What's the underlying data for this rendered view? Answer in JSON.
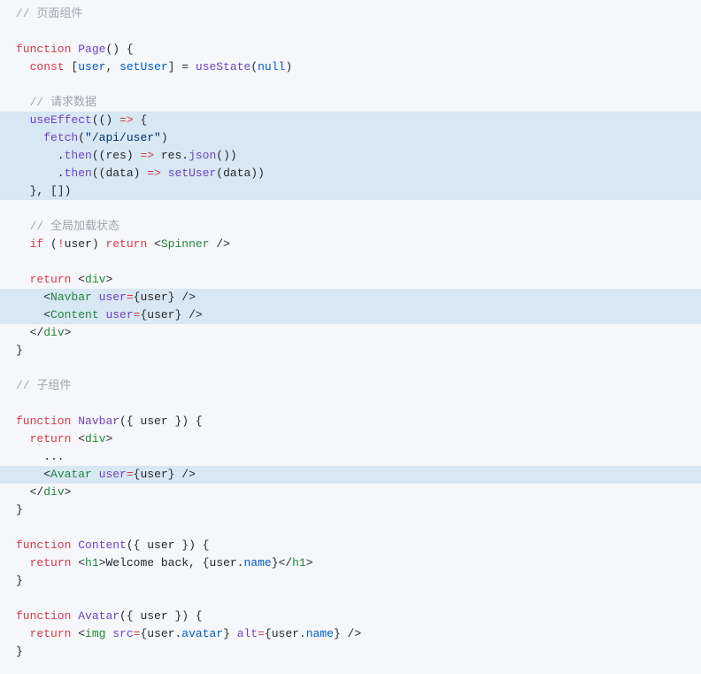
{
  "lines": [
    {
      "hl": false,
      "segs": [
        [
          "c-comment",
          "// 页面组件"
        ]
      ]
    },
    {
      "hl": false,
      "segs": [
        [
          "",
          "  "
        ]
      ]
    },
    {
      "hl": false,
      "segs": [
        [
          "c-keyword",
          "function"
        ],
        [
          "",
          " "
        ],
        [
          "c-func",
          "Page"
        ],
        [
          "c-paren",
          "() {"
        ]
      ]
    },
    {
      "hl": false,
      "segs": [
        [
          "",
          "  "
        ],
        [
          "c-keyword",
          "const"
        ],
        [
          "",
          " ["
        ],
        [
          "c-def",
          "user"
        ],
        [
          "",
          ", "
        ],
        [
          "c-def",
          "setUser"
        ],
        [
          "",
          "] = "
        ],
        [
          "c-func",
          "useState"
        ],
        [
          "",
          "("
        ],
        [
          "c-def",
          "null"
        ],
        [
          "",
          ")"
        ]
      ]
    },
    {
      "hl": false,
      "segs": [
        [
          "",
          "  "
        ]
      ]
    },
    {
      "hl": false,
      "segs": [
        [
          "",
          "  "
        ],
        [
          "c-comment",
          "// 请求数据"
        ]
      ]
    },
    {
      "hl": true,
      "segs": [
        [
          "",
          "  "
        ],
        [
          "c-func",
          "useEffect"
        ],
        [
          "",
          "(() "
        ],
        [
          "c-keyword",
          "=>"
        ],
        [
          "",
          " {"
        ]
      ]
    },
    {
      "hl": true,
      "segs": [
        [
          "",
          "    "
        ],
        [
          "c-func",
          "fetch"
        ],
        [
          "",
          "("
        ],
        [
          "c-string",
          "\"/api/user\""
        ],
        [
          "",
          ")"
        ]
      ]
    },
    {
      "hl": true,
      "segs": [
        [
          "",
          "      ."
        ],
        [
          "c-func",
          "then"
        ],
        [
          "",
          "(("
        ],
        [
          "c-param",
          "res"
        ],
        [
          "",
          ") "
        ],
        [
          "c-keyword",
          "=>"
        ],
        [
          "",
          " res."
        ],
        [
          "c-func",
          "json"
        ],
        [
          "",
          "())"
        ]
      ]
    },
    {
      "hl": true,
      "segs": [
        [
          "",
          "      ."
        ],
        [
          "c-func",
          "then"
        ],
        [
          "",
          "(("
        ],
        [
          "c-param",
          "data"
        ],
        [
          "",
          ") "
        ],
        [
          "c-keyword",
          "=>"
        ],
        [
          "",
          " "
        ],
        [
          "c-func",
          "setUser"
        ],
        [
          "",
          "(data))"
        ]
      ]
    },
    {
      "hl": true,
      "segs": [
        [
          "",
          "  }, [])"
        ]
      ]
    },
    {
      "hl": false,
      "segs": [
        [
          "",
          "  "
        ]
      ]
    },
    {
      "hl": false,
      "segs": [
        [
          "",
          "  "
        ],
        [
          "c-comment",
          "// 全局加载状态"
        ]
      ]
    },
    {
      "hl": false,
      "segs": [
        [
          "",
          "  "
        ],
        [
          "c-keyword",
          "if"
        ],
        [
          "",
          " ("
        ],
        [
          "c-keyword",
          "!"
        ],
        [
          "",
          "user) "
        ],
        [
          "c-keyword",
          "return"
        ],
        [
          "",
          " <"
        ],
        [
          "c-tag",
          "Spinner"
        ],
        [
          "",
          " />"
        ]
      ]
    },
    {
      "hl": false,
      "segs": [
        [
          "",
          "  "
        ]
      ]
    },
    {
      "hl": false,
      "segs": [
        [
          "",
          "  "
        ],
        [
          "c-keyword",
          "return"
        ],
        [
          "",
          " <"
        ],
        [
          "c-tag",
          "div"
        ],
        [
          "",
          ">"
        ]
      ]
    },
    {
      "hl": true,
      "segs": [
        [
          "",
          "    <"
        ],
        [
          "c-tag",
          "Navbar"
        ],
        [
          "",
          " "
        ],
        [
          "c-attr",
          "user"
        ],
        [
          "c-keyword",
          "="
        ],
        [
          "",
          "{user} />"
        ]
      ]
    },
    {
      "hl": true,
      "segs": [
        [
          "",
          "    <"
        ],
        [
          "c-tag",
          "Content"
        ],
        [
          "",
          " "
        ],
        [
          "c-attr",
          "user"
        ],
        [
          "c-keyword",
          "="
        ],
        [
          "",
          "{user} />"
        ]
      ]
    },
    {
      "hl": false,
      "segs": [
        [
          "",
          "  </"
        ],
        [
          "c-tag",
          "div"
        ],
        [
          "",
          ">"
        ]
      ]
    },
    {
      "hl": false,
      "segs": [
        [
          "",
          "}"
        ]
      ]
    },
    {
      "hl": false,
      "segs": [
        [
          "",
          "  "
        ]
      ]
    },
    {
      "hl": false,
      "segs": [
        [
          "c-comment",
          "// 子组件"
        ]
      ]
    },
    {
      "hl": false,
      "segs": [
        [
          "",
          "  "
        ]
      ]
    },
    {
      "hl": false,
      "segs": [
        [
          "c-keyword",
          "function"
        ],
        [
          "",
          " "
        ],
        [
          "c-func",
          "Navbar"
        ],
        [
          "",
          "({ "
        ],
        [
          "c-param",
          "user"
        ],
        [
          "",
          " }) {"
        ]
      ]
    },
    {
      "hl": false,
      "segs": [
        [
          "",
          "  "
        ],
        [
          "c-keyword",
          "return"
        ],
        [
          "",
          " <"
        ],
        [
          "c-tag",
          "div"
        ],
        [
          "",
          ">"
        ]
      ]
    },
    {
      "hl": false,
      "segs": [
        [
          "",
          "    ..."
        ]
      ]
    },
    {
      "hl": true,
      "segs": [
        [
          "",
          "    <"
        ],
        [
          "c-tag",
          "Avatar"
        ],
        [
          "",
          " "
        ],
        [
          "c-attr",
          "user"
        ],
        [
          "c-keyword",
          "="
        ],
        [
          "",
          "{user} />"
        ]
      ]
    },
    {
      "hl": false,
      "segs": [
        [
          "",
          "  </"
        ],
        [
          "c-tag",
          "div"
        ],
        [
          "",
          ">"
        ]
      ]
    },
    {
      "hl": false,
      "segs": [
        [
          "",
          "}"
        ]
      ]
    },
    {
      "hl": false,
      "segs": [
        [
          "",
          "  "
        ]
      ]
    },
    {
      "hl": false,
      "segs": [
        [
          "c-keyword",
          "function"
        ],
        [
          "",
          " "
        ],
        [
          "c-func",
          "Content"
        ],
        [
          "",
          "({ "
        ],
        [
          "c-param",
          "user"
        ],
        [
          "",
          " }) {"
        ]
      ]
    },
    {
      "hl": false,
      "segs": [
        [
          "",
          "  "
        ],
        [
          "c-keyword",
          "return"
        ],
        [
          "",
          " <"
        ],
        [
          "c-tag",
          "h1"
        ],
        [
          "",
          ">Welcome back, {user."
        ],
        [
          "c-prop",
          "name"
        ],
        [
          "",
          "}</"
        ],
        [
          "c-tag",
          "h1"
        ],
        [
          "",
          ">"
        ]
      ]
    },
    {
      "hl": false,
      "segs": [
        [
          "",
          "}"
        ]
      ]
    },
    {
      "hl": false,
      "segs": [
        [
          "",
          "  "
        ]
      ]
    },
    {
      "hl": false,
      "segs": [
        [
          "c-keyword",
          "function"
        ],
        [
          "",
          " "
        ],
        [
          "c-func",
          "Avatar"
        ],
        [
          "",
          "({ "
        ],
        [
          "c-param",
          "user"
        ],
        [
          "",
          " }) {"
        ]
      ]
    },
    {
      "hl": false,
      "segs": [
        [
          "",
          "  "
        ],
        [
          "c-keyword",
          "return"
        ],
        [
          "",
          " <"
        ],
        [
          "c-tag",
          "img"
        ],
        [
          "",
          " "
        ],
        [
          "c-attr",
          "src"
        ],
        [
          "c-keyword",
          "="
        ],
        [
          "",
          "{user."
        ],
        [
          "c-prop",
          "avatar"
        ],
        [
          "",
          "} "
        ],
        [
          "c-attr",
          "alt"
        ],
        [
          "c-keyword",
          "="
        ],
        [
          "",
          "{user."
        ],
        [
          "c-prop",
          "name"
        ],
        [
          "",
          "} />"
        ]
      ]
    },
    {
      "hl": false,
      "segs": [
        [
          "",
          "}"
        ]
      ]
    }
  ]
}
